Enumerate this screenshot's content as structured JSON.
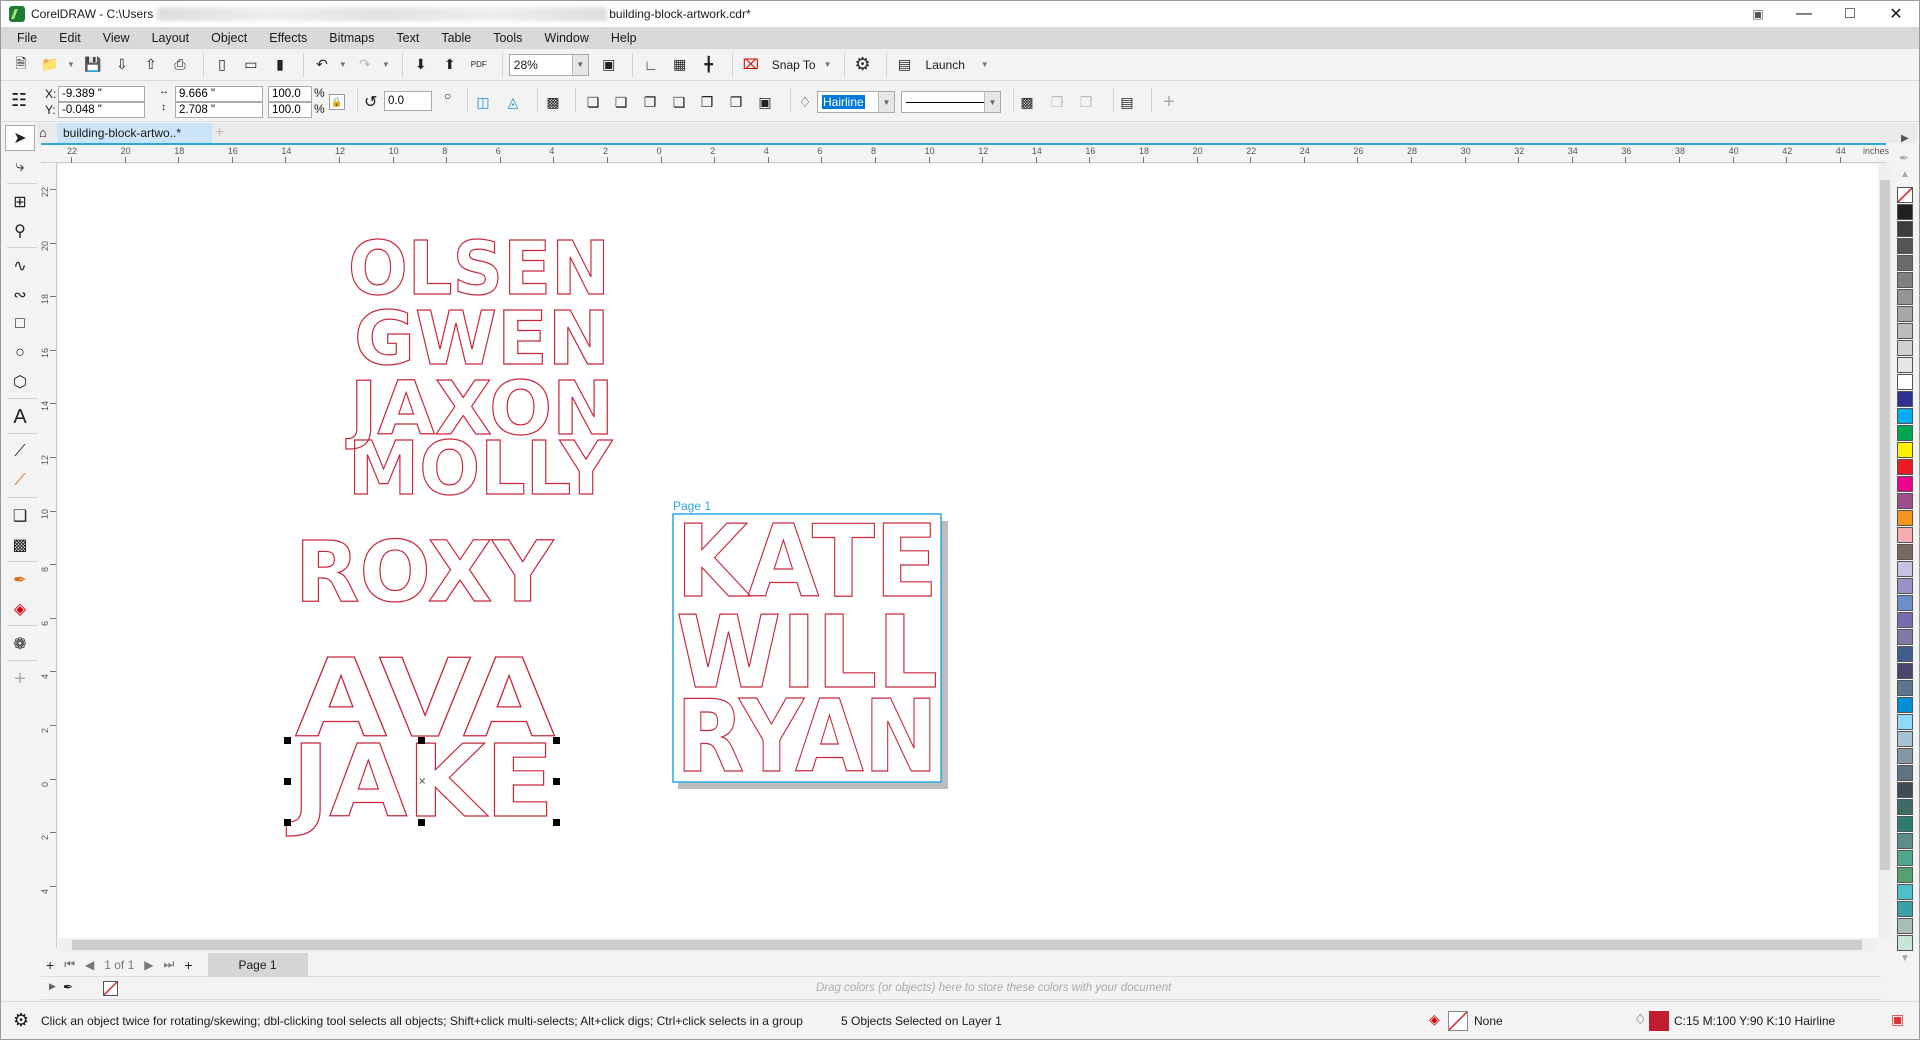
{
  "titlebar": {
    "app_title": "CorelDRAW - C:\\Users",
    "filename": "building-block-artwork.cdr*",
    "buttons": [
      "minimize",
      "maximize",
      "close"
    ]
  },
  "menu": {
    "items": [
      "File",
      "Edit",
      "View",
      "Layout",
      "Object",
      "Effects",
      "Bitmaps",
      "Text",
      "Table",
      "Tools",
      "Window",
      "Help"
    ]
  },
  "standard_toolbar": {
    "zoom_level": "28%",
    "snap_to_label": "Snap To",
    "launch_label": "Launch",
    "pdf_label": "PDF"
  },
  "property_bar": {
    "x_label": "X:",
    "y_label": "Y:",
    "x_value": "-9.389 \"",
    "y_value": "-0.048 \"",
    "width_value": "9.666 \"",
    "height_value": "2.708 \"",
    "scale_w": "100.0",
    "scale_h": "100.0",
    "percent": "%",
    "rotation": "0.0",
    "outline_width": "Hairline"
  },
  "tabs": {
    "document_tab": "building-block-artwo..*"
  },
  "rulers": {
    "unit": "inches",
    "h_ticks": [
      "22",
      "20",
      "18",
      "16",
      "14",
      "12",
      "10",
      "8",
      "6",
      "4",
      "2",
      "0",
      "2",
      "4",
      "6",
      "8",
      "10",
      "12",
      "14",
      "16",
      "18",
      "20",
      "22",
      "24",
      "26",
      "28",
      "30",
      "32",
      "34",
      "36",
      "38",
      "40",
      "42",
      "44"
    ],
    "v_ticks": [
      "22",
      "20",
      "18",
      "16",
      "14",
      "12",
      "10",
      "8",
      "6",
      "4",
      "2",
      "0",
      "2",
      "4"
    ]
  },
  "canvas": {
    "page_label": "Page 1",
    "outline_color": "#c8283c",
    "page_border_color": "#29a9e0",
    "group_left": [
      "OLSEN",
      "GWEN",
      "JAXON",
      "MOLLY"
    ],
    "group_bottom": [
      "ROXY",
      "AVA",
      "JAKE"
    ],
    "group_page": [
      "KATE",
      "WILL",
      "RYAN"
    ]
  },
  "palette": {
    "colors": [
      "#231f20",
      "#3d3d3d",
      "#555555",
      "#6b6b6b",
      "#808080",
      "#959595",
      "#a7a7a7",
      "#bcbcbc",
      "#d1d1d1",
      "#e6e6e6",
      "#ffffff",
      "#2e3192",
      "#00aeef",
      "#00a651",
      "#fff200",
      "#ed1c24",
      "#ec008c",
      "#9e4f8a",
      "#f7941d",
      "#f7acb0",
      "#7b6a63",
      "#c6c3e2",
      "#9a92c7",
      "#6c8ec9",
      "#7a6bb0",
      "#7f79a5",
      "#3f5e8c",
      "#4a466b",
      "#5c7590",
      "#008fd5",
      "#8ed8f8",
      "#a6c2d3",
      "#8497a5",
      "#5f7480",
      "#3f4a52",
      "#3e6b64",
      "#2f7e6b",
      "#5d8e87",
      "#4ea68e",
      "#55a06e",
      "#4cc0c8",
      "#3ba0a8",
      "#a9bfb3",
      "#c9e5d5"
    ]
  },
  "page_nav": {
    "page_count": "1 of 1",
    "page_tab": "Page 1"
  },
  "doc_palette": {
    "hint": "Drag colors (or objects) here to store these colors with your document"
  },
  "status": {
    "hint": "Click an object twice for rotating/skewing; dbl-clicking tool selects all objects; Shift+click multi-selects; Alt+click digs; Ctrl+click selects in a group",
    "selection": "5 Objects Selected on Layer 1",
    "fill": "None",
    "outline": "C:15 M:100 Y:90 K:10  Hairline",
    "outline_swatch": "#be1e2d"
  }
}
